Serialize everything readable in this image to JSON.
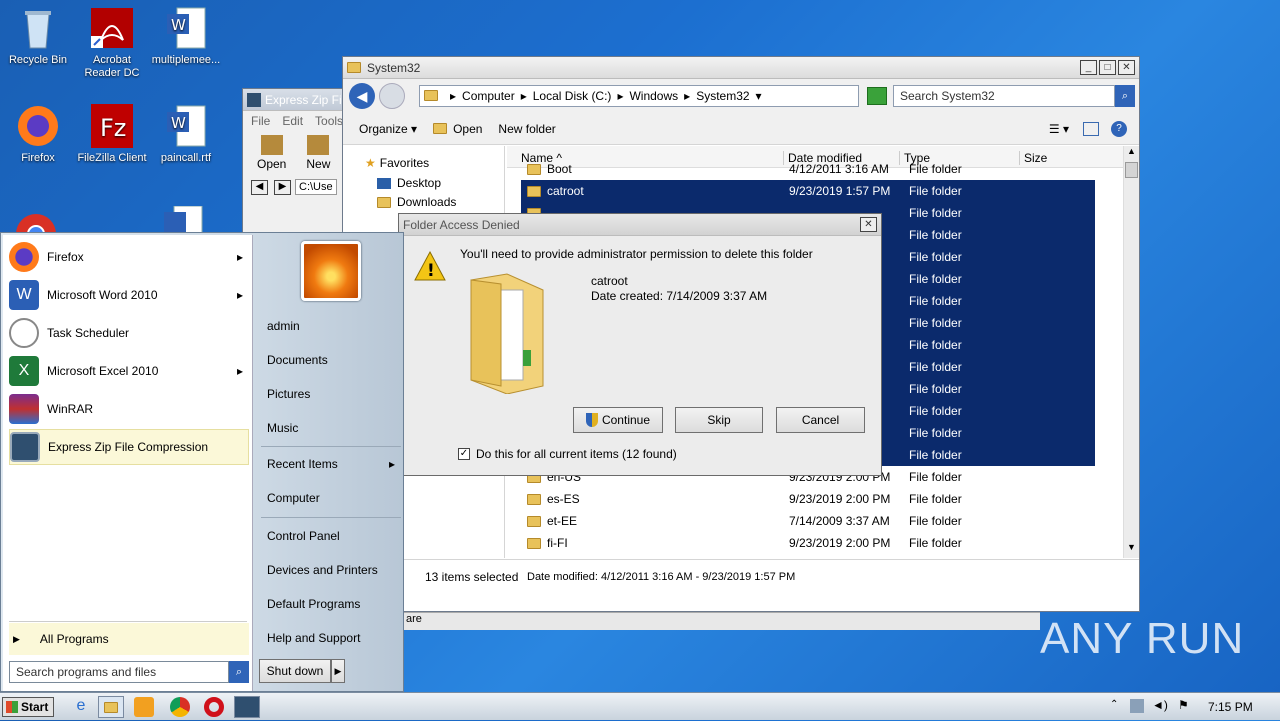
{
  "desktop": {
    "icons": [
      {
        "label": "Recycle Bin"
      },
      {
        "label": "Acrobat Reader DC"
      },
      {
        "label": "multiplemee..."
      },
      {
        "label": "Firefox"
      },
      {
        "label": "FileZilla Client"
      },
      {
        "label": "paincall.rtf"
      }
    ]
  },
  "express_zip": {
    "title": "Express Zip Fi",
    "menu": [
      "File",
      "Edit",
      "Tools"
    ],
    "toolbar": {
      "open": "Open",
      "new": "New"
    },
    "path": "C:\\Use",
    "status_fragment": "are"
  },
  "explorer": {
    "title": "System32",
    "breadcrumb": [
      "Computer",
      "Local Disk (C:)",
      "Windows",
      "System32"
    ],
    "search_placeholder": "Search System32",
    "commands": {
      "organize": "Organize",
      "open": "Open",
      "new_folder": "New folder"
    },
    "nav": {
      "favorites": "Favorites",
      "desktop": "Desktop",
      "downloads": "Downloads"
    },
    "columns": {
      "name": "Name",
      "date": "Date modified",
      "type": "Type",
      "size": "Size"
    },
    "rows": [
      {
        "name": "Boot",
        "date": "4/12/2011 3:16 AM",
        "type": "File folder"
      },
      {
        "name": "catroot",
        "date": "9/23/2019 1:57 PM",
        "type": "File folder"
      },
      {
        "name": "",
        "date": "",
        "type": "File folder"
      },
      {
        "name": "",
        "date": "",
        "type": "File folder"
      },
      {
        "name": "",
        "date": "",
        "type": "File folder"
      },
      {
        "name": "",
        "date": "",
        "type": "File folder"
      },
      {
        "name": "",
        "date": "",
        "type": "File folder"
      },
      {
        "name": "",
        "date": "",
        "type": "File folder"
      },
      {
        "name": "",
        "date": "",
        "type": "File folder"
      },
      {
        "name": "",
        "date": "",
        "type": "File folder"
      },
      {
        "name": "",
        "date": "",
        "type": "File folder"
      },
      {
        "name": "",
        "date": "",
        "type": "File folder"
      },
      {
        "name": "",
        "date": "",
        "type": "File folder"
      },
      {
        "name": "",
        "date": "",
        "type": "File folder"
      },
      {
        "name": "en-US",
        "date": "9/23/2019 2:00 PM",
        "type": "File folder"
      },
      {
        "name": "es-ES",
        "date": "9/23/2019 2:00 PM",
        "type": "File folder"
      },
      {
        "name": "et-EE",
        "date": "7/14/2009 3:37 AM",
        "type": "File folder"
      },
      {
        "name": "fi-FI",
        "date": "9/23/2019 2:00 PM",
        "type": "File folder"
      }
    ],
    "status": {
      "selected": "13 items selected",
      "date_label": "Date modified:",
      "date_range": "4/12/2011 3:16 AM - 9/23/2019 1:57 PM"
    }
  },
  "dialog": {
    "title": "Folder Access Denied",
    "message": "You'll need to provide administrator permission to delete this folder",
    "item_name": "catroot",
    "item_date": "Date created: 7/14/2009 3:37 AM",
    "continue": "Continue",
    "skip": "Skip",
    "cancel": "Cancel",
    "checkbox_label": "Do this for all current items (12 found)",
    "checkbox_checked": true
  },
  "start_menu": {
    "programs": [
      {
        "label": "Firefox",
        "arrow": true
      },
      {
        "label": "Microsoft Word 2010",
        "arrow": true
      },
      {
        "label": "Task Scheduler",
        "arrow": false
      },
      {
        "label": "Microsoft Excel 2010",
        "arrow": true
      },
      {
        "label": "WinRAR",
        "arrow": false
      },
      {
        "label": "Express Zip File Compression",
        "arrow": false
      }
    ],
    "all_programs": "All Programs",
    "search_placeholder": "Search programs and files",
    "right": [
      "admin",
      "Documents",
      "Pictures",
      "Music",
      "Recent Items",
      "Computer",
      "Control Panel",
      "Devices and Printers",
      "Default Programs",
      "Help and Support"
    ],
    "shutdown": "Shut down"
  },
  "taskbar": {
    "start": "Start",
    "clock": "7:15 PM"
  },
  "watermark": "ANY RUN"
}
